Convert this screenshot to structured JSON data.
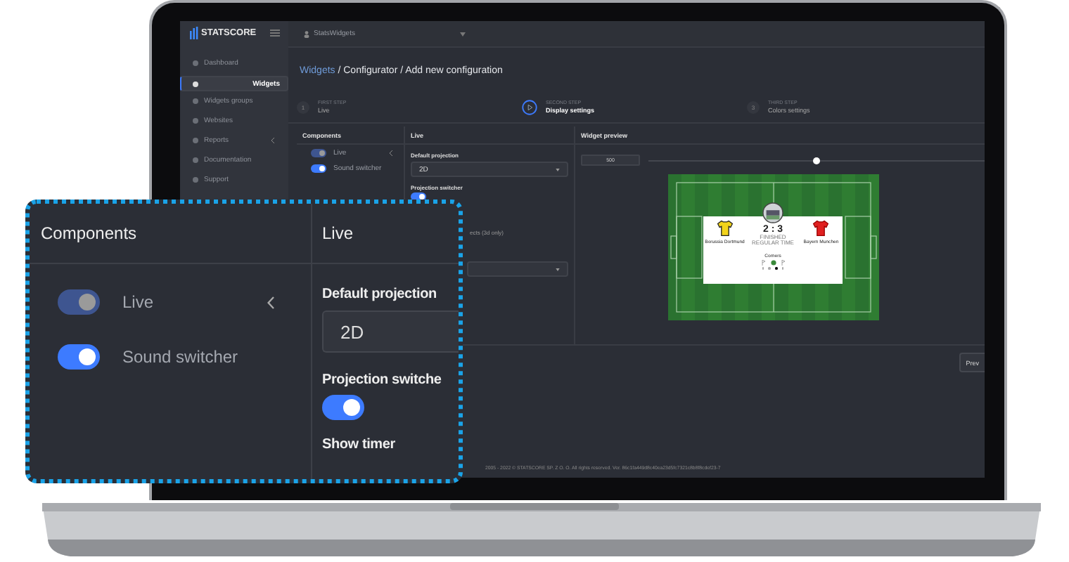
{
  "sidebar": {
    "logo": "STATSCORE",
    "items": [
      {
        "label": "Dashboard",
        "selected": false,
        "expandable": false
      },
      {
        "label": "Widgets",
        "selected": true,
        "expandable": false
      },
      {
        "label": "Widgets groups",
        "selected": false,
        "expandable": false
      },
      {
        "label": "Websites",
        "selected": false,
        "expandable": false
      },
      {
        "label": "Reports",
        "selected": false,
        "expandable": true
      },
      {
        "label": "Documentation",
        "selected": false,
        "expandable": false
      },
      {
        "label": "Support",
        "selected": false,
        "expandable": false
      }
    ]
  },
  "topbar": {
    "app": "StatsWidgets"
  },
  "breadcrumb": {
    "link": "Widgets",
    "rest": "/ Configurator / Add new configuration"
  },
  "steps": [
    {
      "number": "1",
      "caption": "FIRST STEP",
      "title": "Live",
      "selected": false
    },
    {
      "caption": "SECOND STEP",
      "title": "Display settings",
      "selected": true
    },
    {
      "number": "3",
      "caption": "THIRD STEP",
      "title": "Colors settings",
      "selected": false
    }
  ],
  "components": {
    "title": "Components",
    "items": [
      {
        "label": "Live",
        "on": true,
        "disabled": true,
        "expandable": true
      },
      {
        "label": "Sound switcher",
        "on": true,
        "disabled": false,
        "expandable": false
      }
    ]
  },
  "live": {
    "title": "Live",
    "projection_label": "Default projection",
    "projection_value": "2D",
    "switcher_label": "Projection switcher",
    "switcher_on": true,
    "effects_label": "ects (3d only)"
  },
  "preview": {
    "title": "Widget preview",
    "width_value": "500",
    "size_slider": {
      "level": 0.5
    },
    "scoreboard": {
      "home": "Borussia Dortmund",
      "away": "Bayern Munchen",
      "score": "2 : 3",
      "status": "FINISHED REGULAR TIME",
      "stat": "Corners",
      "page_dots": [
        {
          "selected": false
        },
        {
          "selected": false
        },
        {
          "selected": true
        },
        {
          "selected": false
        }
      ]
    }
  },
  "prev_button": "Prev",
  "footer": "2005 - 2022 © STATSCORE SP. Z O. O. All rights reserved. Ver. 86c1fa449d8c40ea23d5fc7321c8b8f8cdef23-7",
  "callout": {
    "components_title": "Components",
    "live_title": "Live",
    "items": [
      {
        "label": "Live",
        "on": true,
        "disabled": true,
        "expandable": true
      },
      {
        "label": "Sound switcher",
        "on": true,
        "disabled": false,
        "expandable": false
      }
    ],
    "projection_label": "Default projection",
    "projection_value": "2D",
    "switcher_label": "Projection switche",
    "switcher_on": true,
    "timer_label": "Show timer"
  }
}
